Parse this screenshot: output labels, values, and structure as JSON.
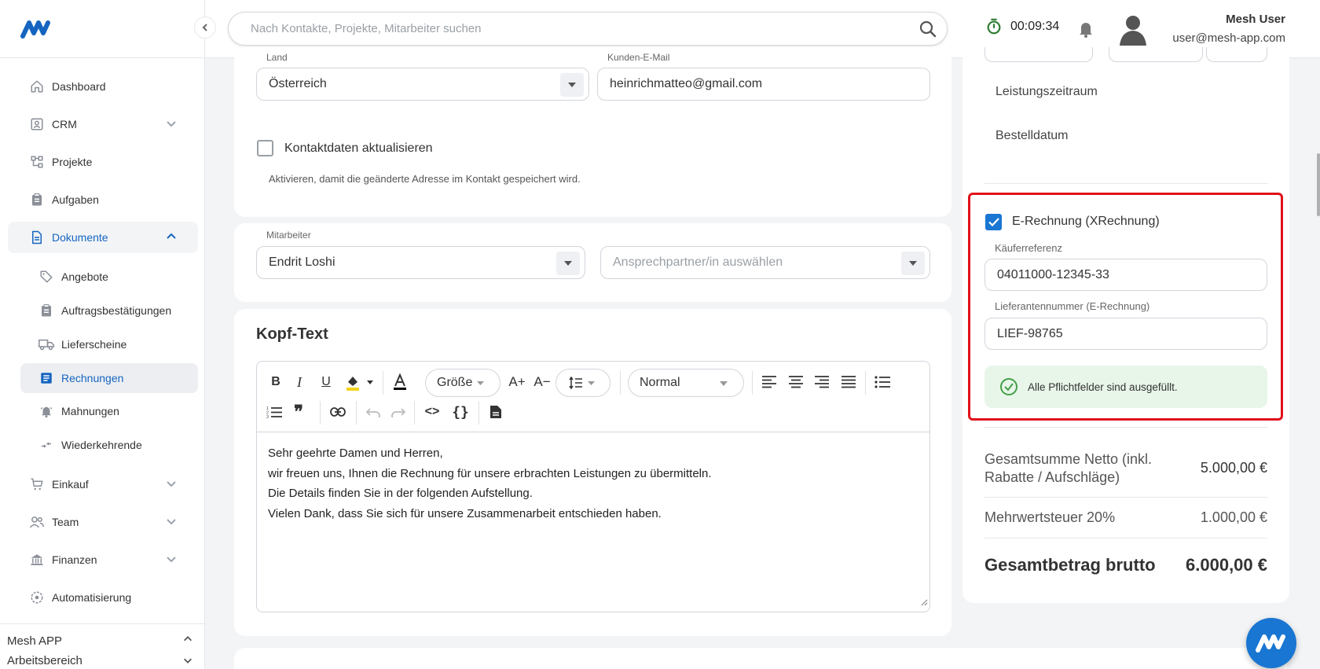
{
  "app": {
    "name": "Mesh APP",
    "workspace": "Arbeitsbereich"
  },
  "colors": {
    "primary": "#1976d2",
    "highlight": "#e0111a",
    "success": "#43a047"
  },
  "topbar": {
    "search_placeholder": "Nach Kontakte, Projekte, Mitarbeiter suchen",
    "timer": "00:09:34",
    "user_name": "Mesh User",
    "user_email": "user@mesh-app.com"
  },
  "sidebar": {
    "items": [
      {
        "label": "Dashboard",
        "icon": "home-icon"
      },
      {
        "label": "CRM",
        "icon": "contacts-icon"
      },
      {
        "label": "Projekte",
        "icon": "projects-icon"
      },
      {
        "label": "Aufgaben",
        "icon": "clipboard-icon"
      },
      {
        "label": "Dokumente",
        "icon": "document-icon"
      },
      {
        "label": "Einkauf",
        "icon": "cart-icon"
      },
      {
        "label": "Team",
        "icon": "team-icon"
      },
      {
        "label": "Finanzen",
        "icon": "bank-icon"
      },
      {
        "label": "Automatisierung",
        "icon": "automation-icon"
      }
    ],
    "sub_items": [
      {
        "label": "Angebote",
        "icon": "tag-icon"
      },
      {
        "label": "Auftragsbestätigungen",
        "icon": "clipboard-icon"
      },
      {
        "label": "Lieferscheine",
        "icon": "truck-icon"
      },
      {
        "label": "Rechnungen",
        "icon": "invoice-icon"
      },
      {
        "label": "Mahnungen",
        "icon": "bell-alert-icon"
      },
      {
        "label": "Wiederkehrende",
        "icon": "recurring-icon"
      }
    ]
  },
  "form": {
    "land_label": "Land",
    "land_value": "Österreich",
    "email_label": "Kunden-E-Mail",
    "email_value": "heinrichmatteo@gmail.com",
    "update_contact_label": "Kontaktdaten aktualisieren",
    "update_contact_hint": "Aktivieren, damit die geänderte Adresse im Kontakt gespeichert wird.",
    "mitarbeiter_label": "Mitarbeiter",
    "mitarbeiter_value": "Endrit Loshi",
    "ansprechpartner_placeholder": "Ansprechpartner/in auswählen"
  },
  "kopftext": {
    "title": "Kopf-Text",
    "size_label": "Größe",
    "style_label": "Normal",
    "lines": [
      "Sehr geehrte Damen und Herren,",
      "wir freuen uns, Ihnen die Rechnung für unsere erbrachten Leistungen zu übermitteln.",
      "Die Details finden Sie in der folgenden Aufstellung.",
      "Vielen Dank, dass Sie sich für unsere Zusammenarbeit entschieden haben."
    ]
  },
  "right": {
    "leistungszeitraum": "Leistungszeitraum",
    "bestelldatum": "Bestelldatum",
    "erechnung_label": "E-Rechnung (XRechnung)",
    "erechnung_checked": true,
    "kaeuferreferenz_label": "Käuferreferenz",
    "kaeuferreferenz_value": "04011000-12345-33",
    "lieferantennummer_label": "Lieferantennummer (E-Rechnung)",
    "lieferantennummer_value": "LIEF-98765",
    "status_text": "Alle Pflichtfelder sind ausgefüllt."
  },
  "totals": {
    "netto_label": "Gesamtsumme Netto (inkl. Rabatte / Aufschläge)",
    "netto_value": "5.000,00 €",
    "mwst_label": "Mehrwertsteuer 20%",
    "mwst_value": "1.000,00 €",
    "brutto_label": "Gesamtbetrag brutto",
    "brutto_value": "6.000,00 €"
  }
}
